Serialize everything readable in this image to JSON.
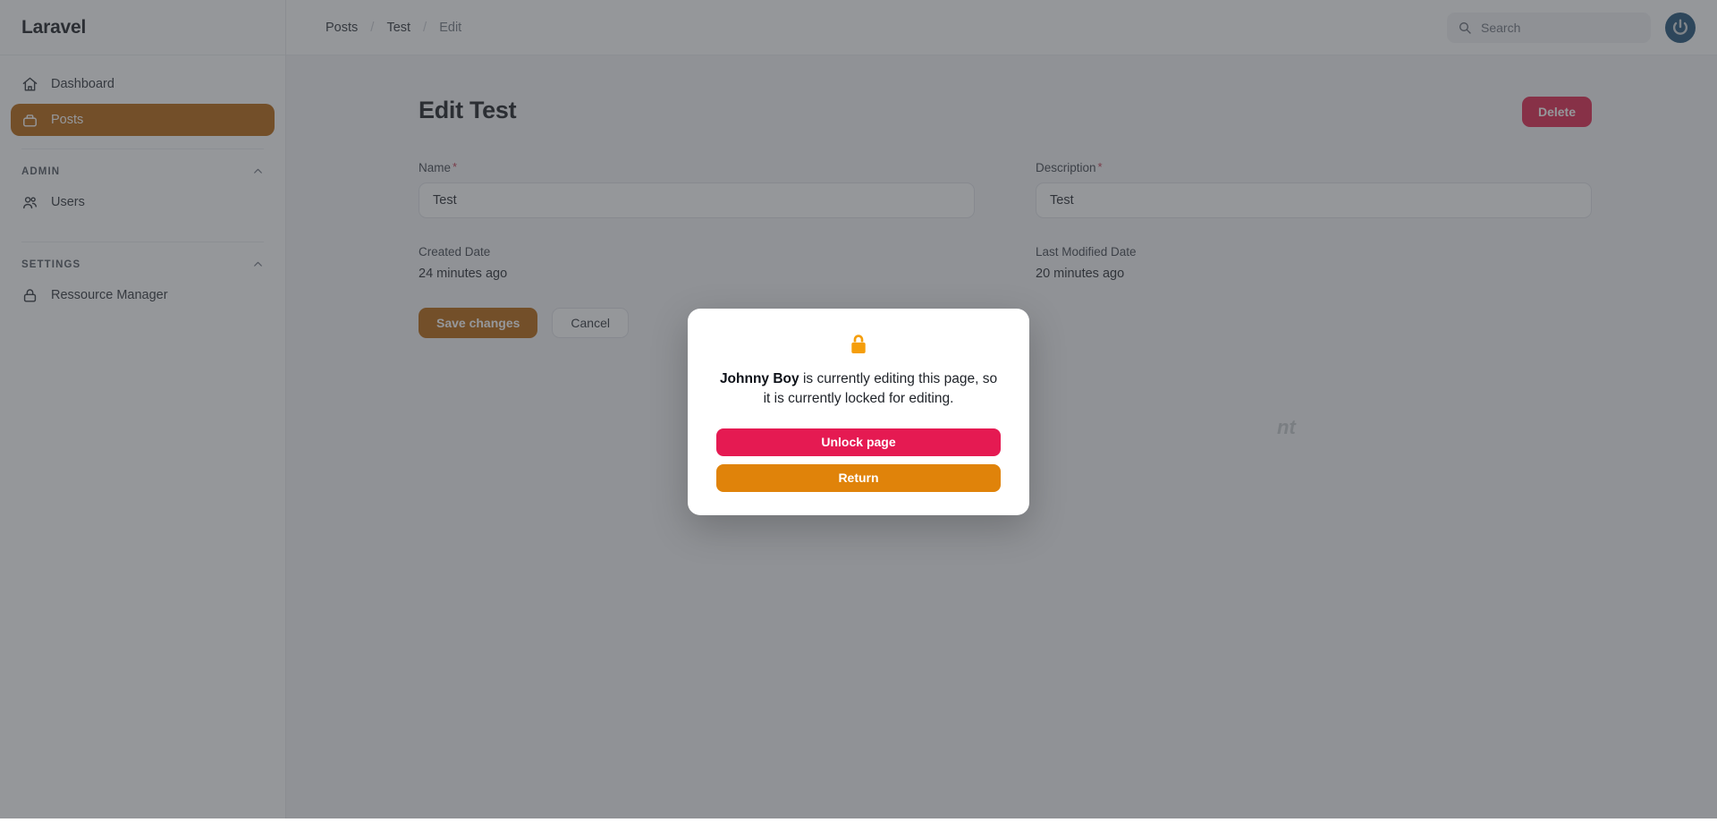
{
  "sidebar": {
    "brand": "Laravel",
    "primary_items": [
      {
        "label": "Dashboard",
        "icon": "home-icon",
        "active": false
      },
      {
        "label": "Posts",
        "icon": "briefcase-icon",
        "active": true
      }
    ],
    "groups": [
      {
        "label": "ADMIN",
        "collapse_icon": "chevron-up-icon",
        "items": [
          {
            "label": "Users",
            "icon": "users-icon"
          }
        ]
      },
      {
        "label": "SETTINGS",
        "collapse_icon": "chevron-up-icon",
        "items": [
          {
            "label": "Ressource Manager",
            "icon": "lock-icon"
          }
        ]
      }
    ]
  },
  "topbar": {
    "breadcrumb": [
      {
        "label": "Posts",
        "current": false
      },
      {
        "label": "Test",
        "current": false
      },
      {
        "label": "Edit",
        "current": true
      }
    ],
    "separator": "/",
    "search": {
      "placeholder": "Search",
      "value": "",
      "icon": "search-icon"
    },
    "avatar": {
      "icon": "power-avatar-icon"
    }
  },
  "page": {
    "title": "Edit Test",
    "delete_label": "Delete",
    "ghost_note": "nt",
    "fields": [
      {
        "label": "Name",
        "required": true,
        "required_marker": "*",
        "value": "Test"
      },
      {
        "label": "Description",
        "required": true,
        "required_marker": "*",
        "value": "Test"
      }
    ],
    "meta": [
      {
        "label": "Created Date",
        "value": "24 minutes ago"
      },
      {
        "label": "Last Modified Date",
        "value": "20 minutes ago"
      }
    ],
    "save_label": "Save changes",
    "cancel_label": "Cancel"
  },
  "modal": {
    "lock_icon": "lock-icon",
    "user": "Johnny Boy",
    "message_rest": " is currently editing this page, so it is currently locked for editing.",
    "unlock_label": "Unlock page",
    "return_label": "Return"
  },
  "colors": {
    "brand_orange": "#b45f06",
    "danger_pink": "#e11d48",
    "modal_unlock": "#e51a52",
    "modal_return": "#e0830a",
    "lock_amber": "#f59e0b",
    "avatar_blue": "#1a4d73",
    "page_bg": "#f3f4f6"
  }
}
